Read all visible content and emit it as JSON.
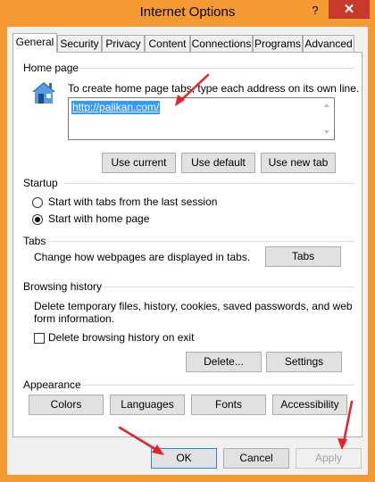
{
  "window": {
    "title": "Internet Options",
    "help": "?",
    "close": "✕"
  },
  "tabs": [
    {
      "label": "General",
      "active": true
    },
    {
      "label": "Security"
    },
    {
      "label": "Privacy"
    },
    {
      "label": "Content"
    },
    {
      "label": "Connections"
    },
    {
      "label": "Programs"
    },
    {
      "label": "Advanced"
    }
  ],
  "home_page": {
    "section": "Home page",
    "instruction": "To create home page tabs, type each address on its own line.",
    "url": "http://palikan.com/",
    "use_current": "Use current",
    "use_default": "Use default",
    "use_new_tab": "Use new tab"
  },
  "startup": {
    "section": "Startup",
    "option_last_session": "Start with tabs from the last session",
    "option_home_page": "Start with home page",
    "selected": "home_page"
  },
  "tabs_section": {
    "section": "Tabs",
    "description": "Change how webpages are displayed in tabs.",
    "button": "Tabs"
  },
  "browsing_history": {
    "section": "Browsing history",
    "description_line1": "Delete temporary files, history, cookies, saved passwords, and web",
    "description_line2": "form information.",
    "delete_on_exit": "Delete browsing history on exit",
    "delete_on_exit_checked": false,
    "delete_button": "Delete...",
    "settings_button": "Settings"
  },
  "appearance": {
    "section": "Appearance",
    "colors": "Colors",
    "languages": "Languages",
    "fonts": "Fonts",
    "accessibility": "Accessibility"
  },
  "footer": {
    "ok": "OK",
    "cancel": "Cancel",
    "apply": "Apply",
    "apply_enabled": false
  },
  "colors": {
    "title_bar": "#f59a33",
    "close": "#c7392b",
    "selection": "#3399ff",
    "annotation_arrow": "#e8202a"
  }
}
